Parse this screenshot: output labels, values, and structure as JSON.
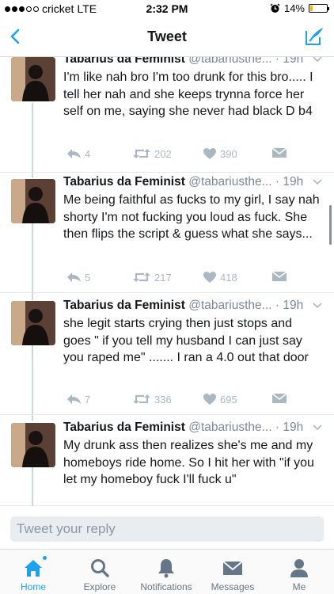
{
  "status_bar": {
    "carrier": "cricket",
    "network": "LTE",
    "time": "2:32 PM",
    "battery": "14%",
    "battery_level": 0.14
  },
  "nav": {
    "title": "Tweet"
  },
  "tweets": [
    {
      "name": "Tabarius da Feminist",
      "handle": "@tabariusthe...",
      "time": "· 19h",
      "text": "I'm like nah bro I'm too drunk for this bro..... I tell her nah and she keeps trynna force her self on me, saying she never had black D b4",
      "replies": "4",
      "retweets": "202",
      "likes": "390"
    },
    {
      "name": "Tabarius da Feminist",
      "handle": "@tabariusthe...",
      "time": "· 19h",
      "text": "Me being faithful as fucks to my girl, I say nah shorty I'm not fucking you loud as fuck. She then flips the script & guess what she says...",
      "replies": "5",
      "retweets": "217",
      "likes": "418"
    },
    {
      "name": "Tabarius da Feminist",
      "handle": "@tabariusthe...",
      "time": "· 19h",
      "text": "she legit starts crying then just stops and goes \" if you tell my husband I can just say you raped me\" ....... I ran a 4.0 out that door",
      "replies": "7",
      "retweets": "336",
      "likes": "695"
    },
    {
      "name": "Tabarius da Feminist",
      "handle": "@tabariusthe...",
      "time": "· 19h",
      "text": "My drunk ass then realizes she's me and my homeboys ride home. So I hit her with \"if you let my homeboy fuck I'll fuck u\"",
      "replies": "",
      "retweets": "",
      "likes": ""
    }
  ],
  "reply": {
    "placeholder": "Tweet your reply"
  },
  "tabs": [
    {
      "label": "Home",
      "icon": "home-icon"
    },
    {
      "label": "Explore",
      "icon": "search-icon"
    },
    {
      "label": "Notifications",
      "icon": "bell-icon"
    },
    {
      "label": "Messages",
      "icon": "mail-icon"
    },
    {
      "label": "Me",
      "icon": "person-icon"
    }
  ],
  "colors": {
    "accent": "#1da1f2",
    "muted": "#aab8c2",
    "text": "#14171a",
    "secondary": "#7b8794"
  }
}
